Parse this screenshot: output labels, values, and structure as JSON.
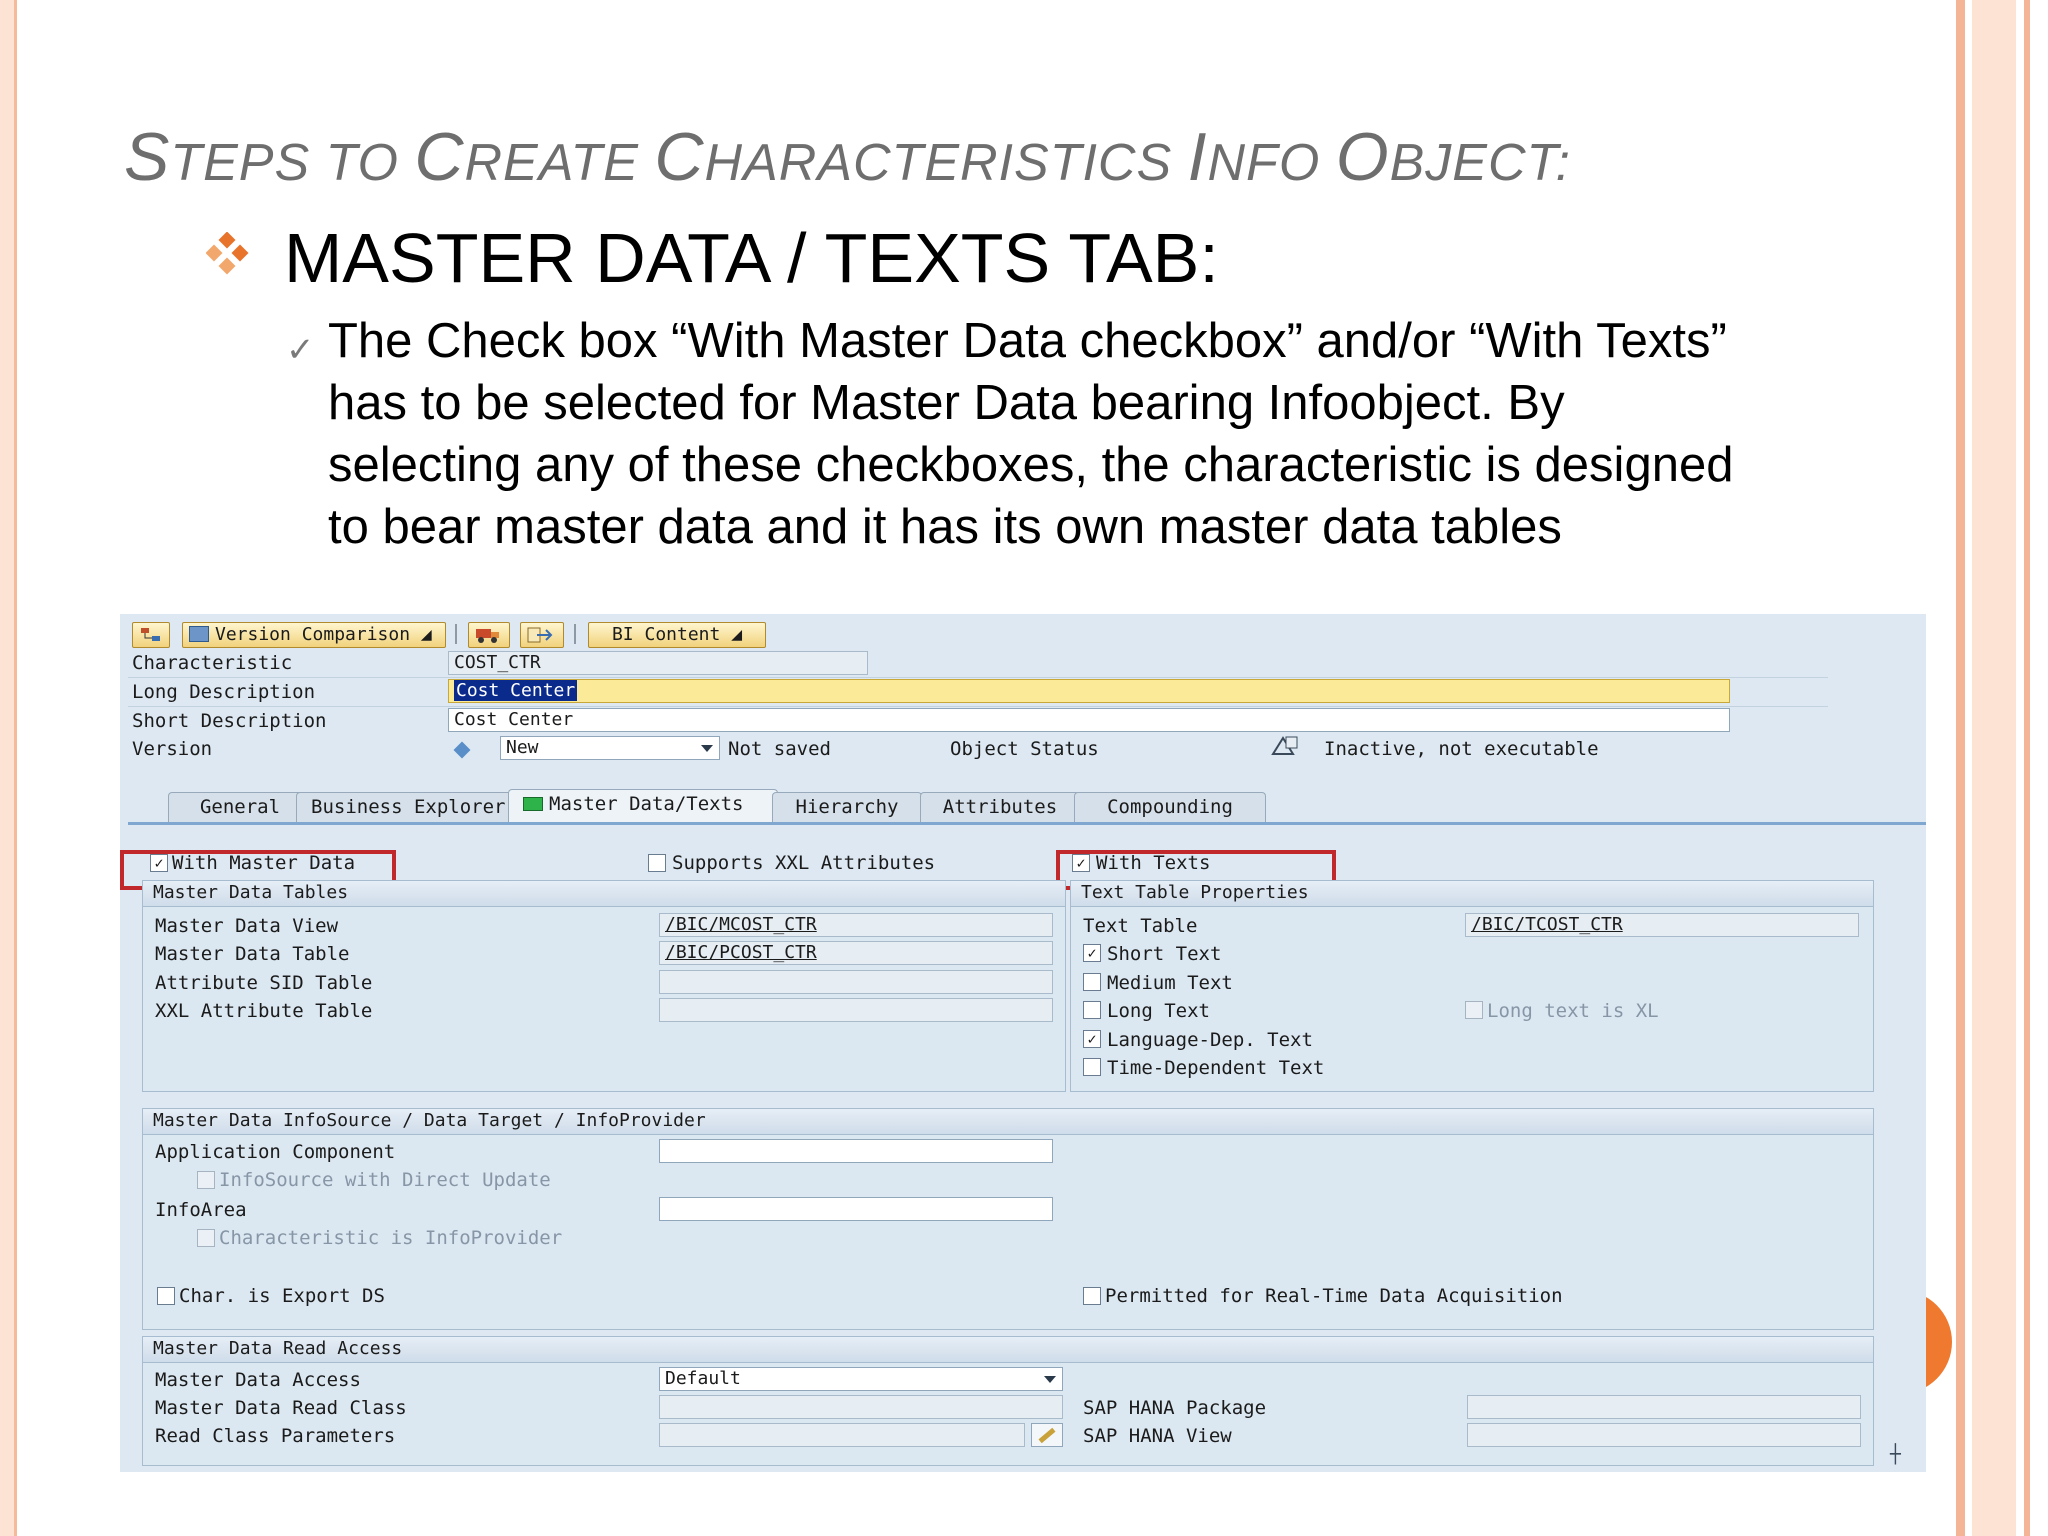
{
  "slide": {
    "title_initials": [
      "S",
      "C",
      "C",
      "I",
      "O"
    ],
    "title_parts": [
      "S",
      "TEPS TO ",
      "C",
      "REATE ",
      "C",
      "HARACTERISTICS ",
      "I",
      "NFO ",
      "O",
      "BJECT:"
    ],
    "bullet_heading": "MASTER DATA / TEXTS TAB:",
    "bullet_text": "The Check box “With Master Data checkbox” and/or “With Texts” has to be selected for Master Data bearing Infoobject. By selecting any of these checkboxes, the characteristic is designed to bear master data and it has its own master data tables",
    "colors": {
      "stripe": "#f6b99a",
      "accent": "#e8732a",
      "title": "#6e6e6e"
    }
  },
  "sap": {
    "toolbar": {
      "version_comparison": "Version Comparison",
      "bi_content": "BI Content"
    },
    "header": {
      "characteristic_label": "Characteristic",
      "characteristic_value": "COST_CTR",
      "long_desc_label": "Long Description",
      "long_desc_value": "Cost Center",
      "short_desc_label": "Short Description",
      "short_desc_value": "Cost Center",
      "version_label": "Version",
      "version_value": "New",
      "version_status": "Not saved",
      "object_status_label": "Object Status",
      "object_status_value": "Inactive, not executable"
    },
    "tabs": [
      "General",
      "Business Explorer",
      "Master Data/Texts",
      "Hierarchy",
      "Attributes",
      "Compounding"
    ],
    "top_checks": {
      "with_master_data": "With Master Data",
      "supports_xxl": "Supports XXL Attributes",
      "with_texts": "With Texts"
    },
    "md_tables": {
      "title": "Master Data Tables",
      "rows": [
        {
          "label": "Master Data View",
          "value": "/BIC/MCOST_CTR"
        },
        {
          "label": "Master Data Table",
          "value": "/BIC/PCOST_CTR"
        },
        {
          "label": "Attribute SID Table",
          "value": ""
        },
        {
          "label": "XXL Attribute Table",
          "value": ""
        }
      ]
    },
    "text_props": {
      "title": "Text Table Properties",
      "text_table_label": "Text Table",
      "text_table_value": "/BIC/TCOST_CTR",
      "short_text": "Short Text",
      "medium_text": "Medium Text",
      "long_text": "Long Text",
      "long_text_xl": "Long text is XL",
      "lang_dep": "Language-Dep. Text",
      "time_dep": "Time-Dependent Text"
    },
    "infosource": {
      "title": "Master Data InfoSource / Data Target / InfoProvider",
      "app_component": "Application Component",
      "infosource_direct": "InfoSource with Direct Update",
      "infoarea": "InfoArea",
      "char_infoprovider": "Characteristic is InfoProvider",
      "char_export": "Char. is Export DS",
      "realtime": "Permitted for Real-Time Data Acquisition"
    },
    "read_access": {
      "title": "Master Data Read Access",
      "access_label": "Master Data Access",
      "access_value": "Default",
      "read_class": "Master Data Read Class",
      "read_params": "Read Class Parameters",
      "hana_package": "SAP HANA Package",
      "hana_view": "SAP HANA View"
    }
  }
}
